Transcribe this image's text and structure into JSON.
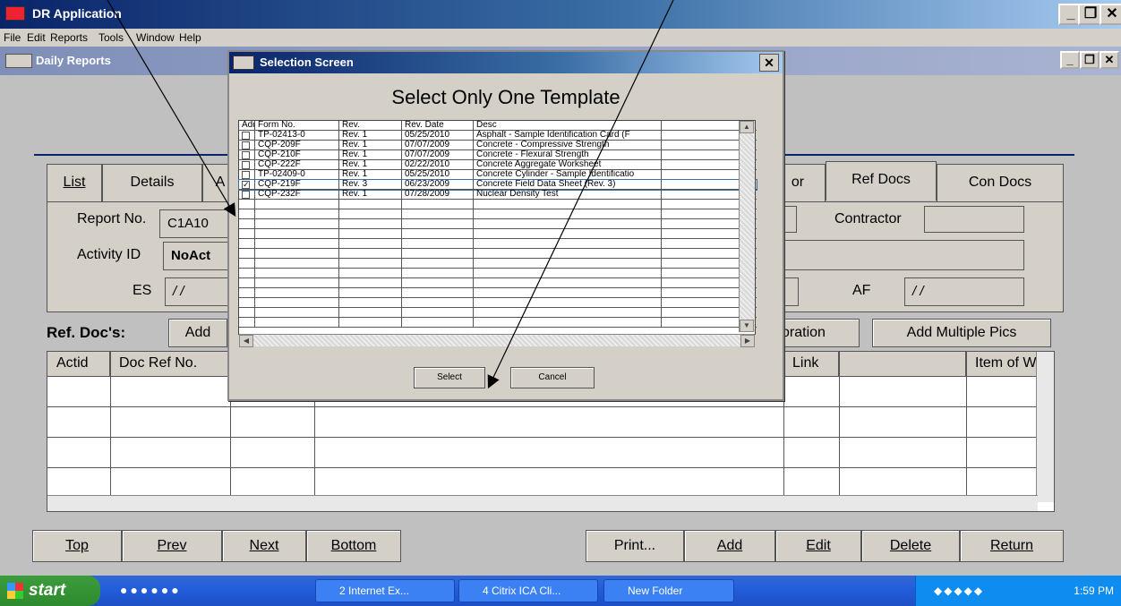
{
  "app": {
    "title": "DR Application",
    "menu": [
      "File",
      "Edit",
      "Reports",
      "Tools",
      "Window",
      "Help"
    ]
  },
  "mdi": {
    "title": "Daily Reports"
  },
  "tabs": [
    "List",
    "Details",
    "A",
    "or",
    "Ref Docs",
    "Con Docs"
  ],
  "form": {
    "report_no_label": "Report No.",
    "report_no_value": "C1A10",
    "contractor_label": "Contractor",
    "activity_id_label": "Activity ID",
    "activity_id_value": "NoAct",
    "es_label": "ES",
    "es_value": "/ /",
    "af_label": "AF",
    "af_value": "/ /"
  },
  "refdocs": {
    "label": "Ref. Doc's:",
    "add_button": "Add",
    "oration_button": "oration",
    "add_multiple_pics_button": "Add Multiple Pics"
  },
  "grid": {
    "headers": [
      "Actid",
      "Doc Ref No.",
      "",
      "",
      "Link",
      "",
      "Item of W"
    ]
  },
  "bottom_buttons": [
    "Top",
    "Prev",
    "Next",
    "Bottom",
    "Print...",
    "Add",
    "Edit",
    "Delete",
    "Return"
  ],
  "taskbar": {
    "start": "start",
    "items": [
      "2 Internet Ex...",
      "4 Citrix ICA Cli...",
      "New Folder"
    ],
    "clock": "1:59 PM"
  },
  "dialog": {
    "title": "Selection Screen",
    "heading": "Select Only One Template",
    "columns": [
      "Add",
      "Form No.",
      "Rev.",
      "Rev. Date",
      "Desc"
    ],
    "rows": [
      {
        "checked": false,
        "form_no": "TP-02413-0",
        "rev": "Rev. 1",
        "date": "05/25/2010",
        "desc": "Asphalt - Sample Identification Card (F"
      },
      {
        "checked": false,
        "form_no": "CQP-209F",
        "rev": "Rev. 1",
        "date": "07/07/2009",
        "desc": "Concrete - Compressive Strength"
      },
      {
        "checked": false,
        "form_no": "CQP-210F",
        "rev": "Rev. 1",
        "date": "07/07/2009",
        "desc": "Concrete - Flexural Strength"
      },
      {
        "checked": false,
        "form_no": "CQP-222F",
        "rev": "Rev. 1",
        "date": "02/22/2010",
        "desc": "Concrete Aggregate Worksheet"
      },
      {
        "checked": false,
        "form_no": "TP-02409-0",
        "rev": "Rev. 1",
        "date": "05/25/2010",
        "desc": "Concrete Cylinder - Sample Identificatio"
      },
      {
        "checked": true,
        "form_no": "CQP-219F",
        "rev": "Rev. 3",
        "date": "06/23/2009",
        "desc": "Concrete Field Data Sheet (Rev. 3)"
      },
      {
        "checked": false,
        "form_no": "CQP-232F",
        "rev": "Rev. 1",
        "date": "07/28/2009",
        "desc": "Nuclear Density Test"
      }
    ],
    "select_button": "Select",
    "cancel_button": "Cancel"
  }
}
